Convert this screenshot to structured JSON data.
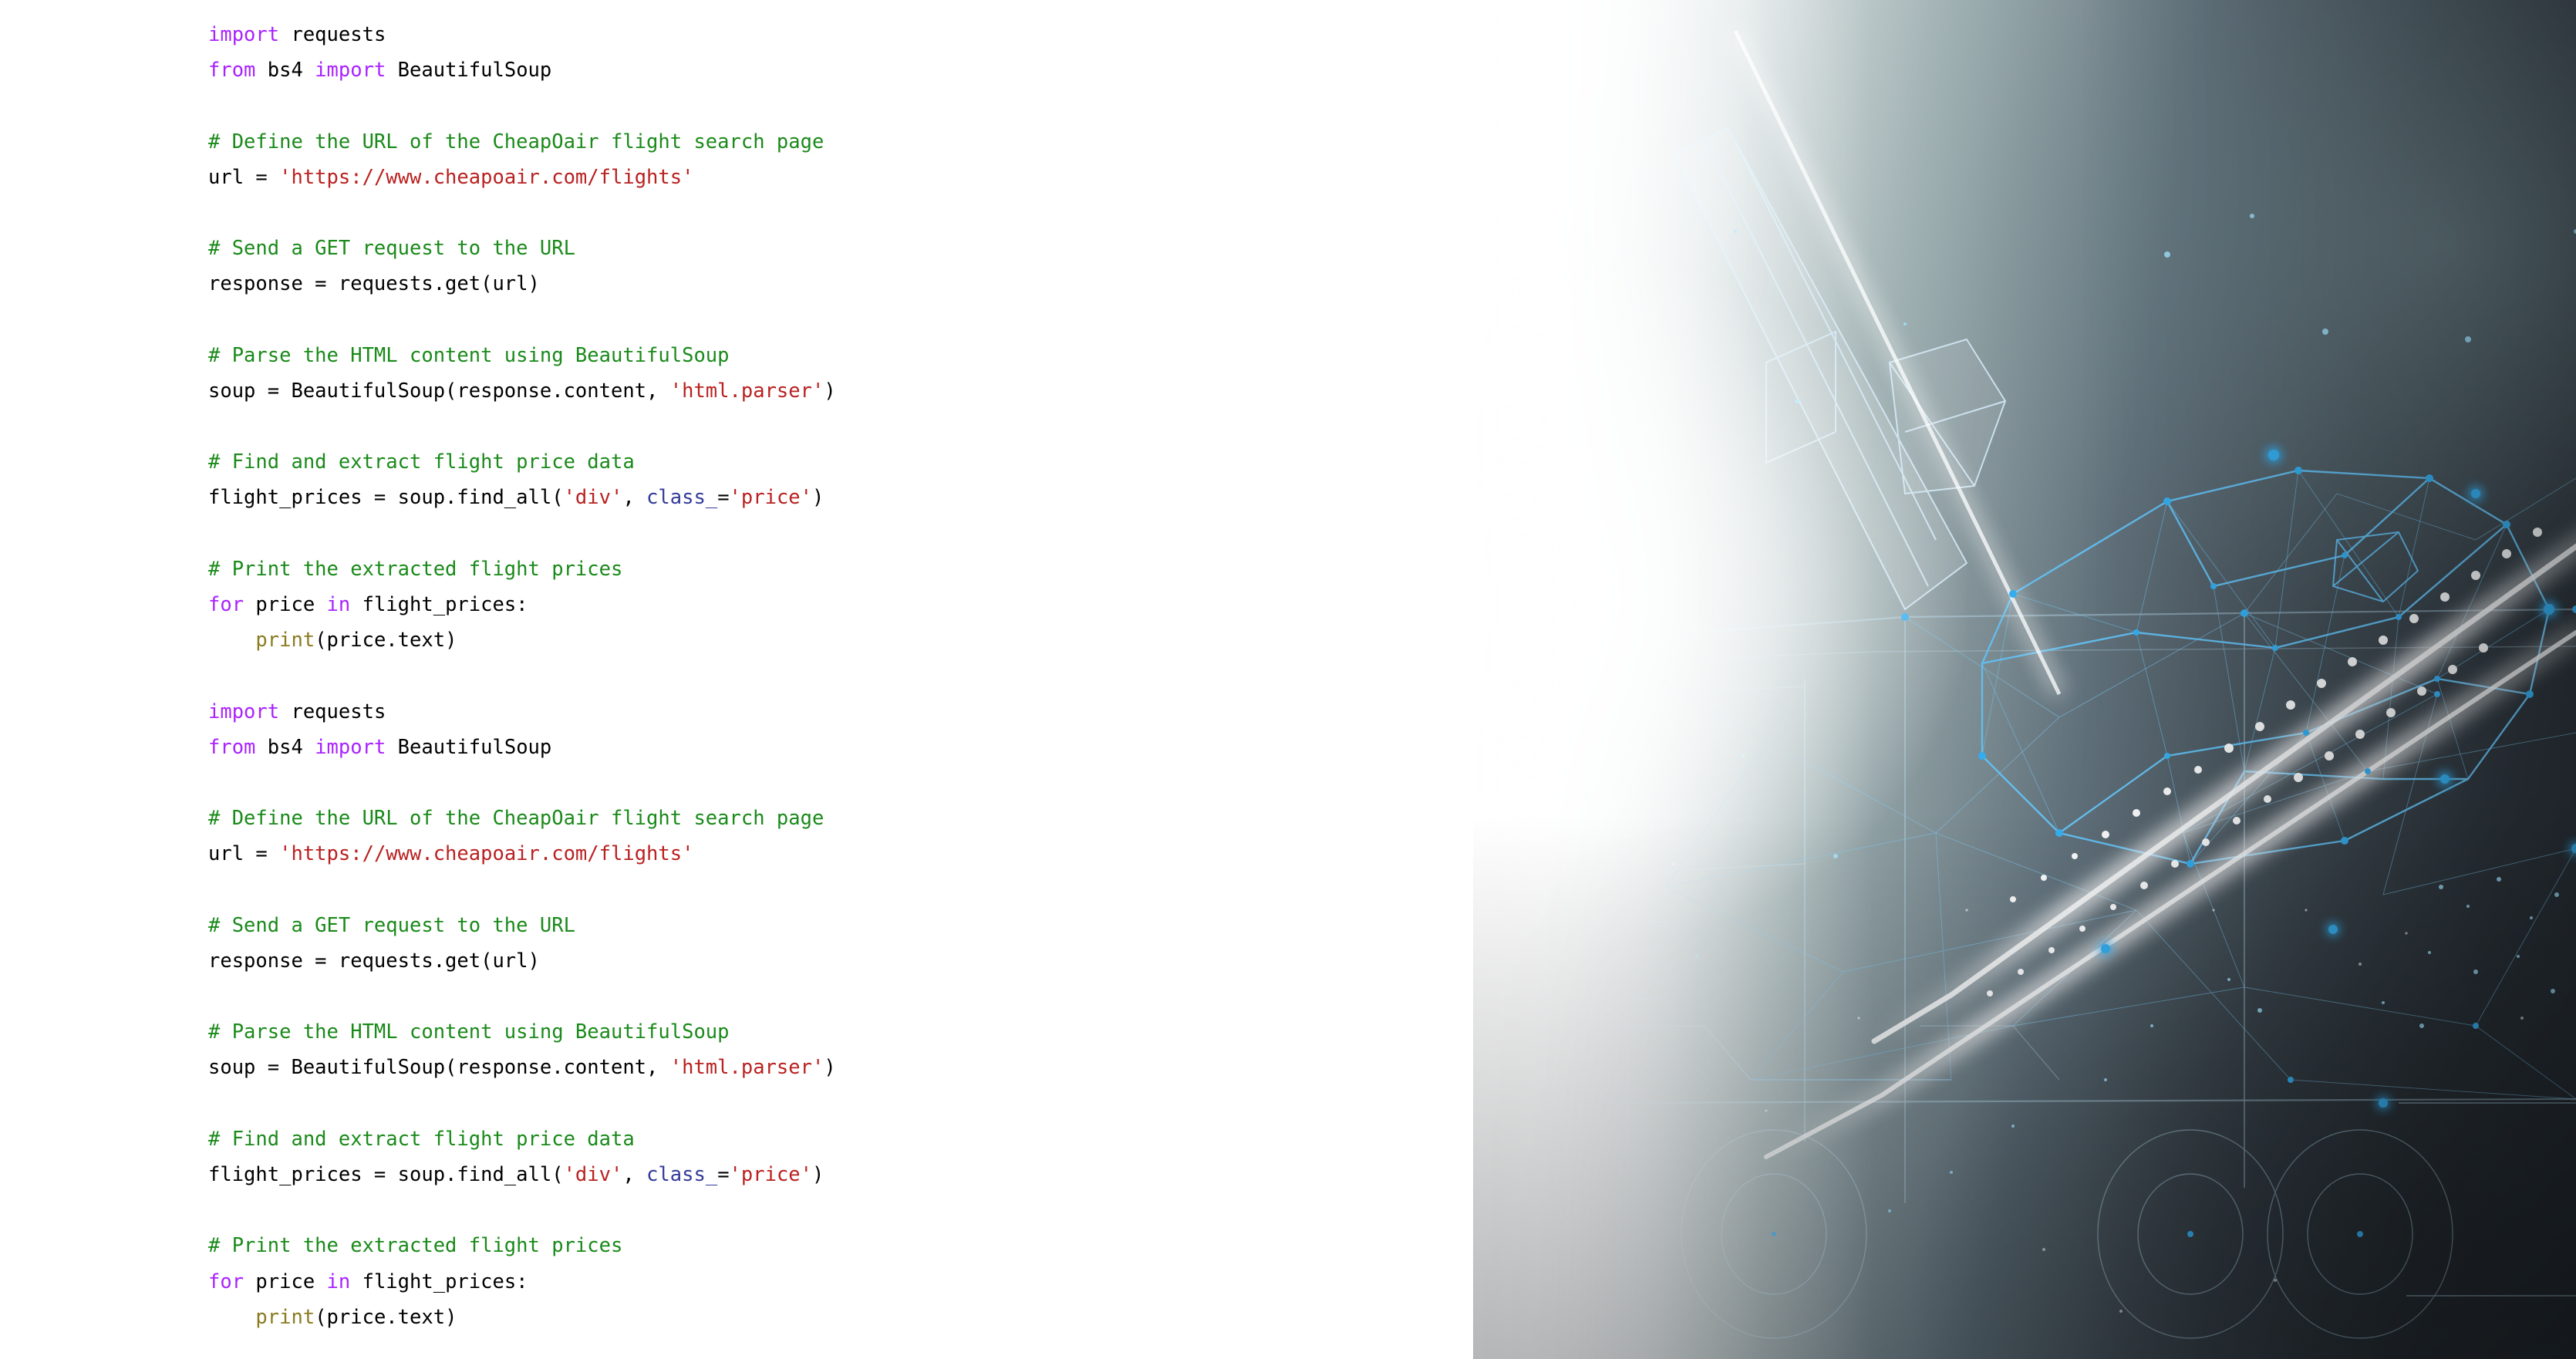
{
  "slide": {
    "background_color": "#ffffff",
    "accent_light_color": "#85B3E6",
    "accent_dark_color": "#1B4676"
  },
  "hero_image": {
    "name": "low-poly-wireframe-airplane-and-truck-logistics-graphic",
    "description": "Abstract polygonal wireframe of an airliner taking off above a cargo truck, glowing blue nodes and connecting lines over a grey-to-white gradient background",
    "accent_node_color": "#3FB0F2",
    "line_color": "#8FD2F7",
    "glow_color": "#CFEFFF"
  },
  "code": {
    "language": "python",
    "font_size_px": 25.5,
    "colors": {
      "keyword": "#AA22FF",
      "comment": "#1A8A1A",
      "string": "#BA2121",
      "builtin": "#8A7B1F",
      "keyword_argument": "#333B99",
      "text": "#000000"
    },
    "blocks": [
      {
        "name": "code-block-1",
        "lines": [
          [
            {
              "t": "import",
              "c": "kw"
            },
            {
              "t": " requests",
              "c": "txt"
            }
          ],
          [
            {
              "t": "from",
              "c": "kw"
            },
            {
              "t": " bs4 ",
              "c": "txt"
            },
            {
              "t": "import",
              "c": "kw"
            },
            {
              "t": " BeautifulSoup",
              "c": "txt"
            }
          ],
          [],
          [
            {
              "t": "# Define the URL of the CheapOair flight search page",
              "c": "cmt"
            }
          ],
          [
            {
              "t": "url = ",
              "c": "txt"
            },
            {
              "t": "'https://www.cheapoair.com/flights'",
              "c": "str"
            }
          ],
          [],
          [
            {
              "t": "# Send a GET request to the URL",
              "c": "cmt"
            }
          ],
          [
            {
              "t": "response = requests.get(url)",
              "c": "txt"
            }
          ],
          [],
          [
            {
              "t": "# Parse the HTML content using BeautifulSoup",
              "c": "cmt"
            }
          ],
          [
            {
              "t": "soup = BeautifulSoup(response.content, ",
              "c": "txt"
            },
            {
              "t": "'html.parser'",
              "c": "str"
            },
            {
              "t": ")",
              "c": "txt"
            }
          ],
          [],
          [
            {
              "t": "# Find and extract flight price data",
              "c": "cmt"
            }
          ],
          [
            {
              "t": "flight_prices = soup.find_all(",
              "c": "txt"
            },
            {
              "t": "'div'",
              "c": "str"
            },
            {
              "t": ", ",
              "c": "txt"
            },
            {
              "t": "class_",
              "c": "kwa"
            },
            {
              "t": "=",
              "c": "txt"
            },
            {
              "t": "'price'",
              "c": "str"
            },
            {
              "t": ")",
              "c": "txt"
            }
          ],
          [],
          [
            {
              "t": "# Print the extracted flight prices",
              "c": "cmt"
            }
          ],
          [
            {
              "t": "for",
              "c": "kw"
            },
            {
              "t": " price ",
              "c": "txt"
            },
            {
              "t": "in",
              "c": "kw"
            },
            {
              "t": " flight_prices:",
              "c": "txt"
            }
          ],
          [
            {
              "t": "    ",
              "c": "txt"
            },
            {
              "t": "print",
              "c": "bfn"
            },
            {
              "t": "(price.text)",
              "c": "txt"
            }
          ]
        ]
      },
      {
        "name": "code-block-2",
        "lines": [
          [],
          [
            {
              "t": "import",
              "c": "kw"
            },
            {
              "t": " requests",
              "c": "txt"
            }
          ],
          [
            {
              "t": "from",
              "c": "kw"
            },
            {
              "t": " bs4 ",
              "c": "txt"
            },
            {
              "t": "import",
              "c": "kw"
            },
            {
              "t": " BeautifulSoup",
              "c": "txt"
            }
          ],
          [],
          [
            {
              "t": "# Define the URL of the CheapOair flight search page",
              "c": "cmt"
            }
          ],
          [
            {
              "t": "url = ",
              "c": "txt"
            },
            {
              "t": "'https://www.cheapoair.com/flights'",
              "c": "str"
            }
          ],
          [],
          [
            {
              "t": "# Send a GET request to the URL",
              "c": "cmt"
            }
          ],
          [
            {
              "t": "response = requests.get(url)",
              "c": "txt"
            }
          ],
          [],
          [
            {
              "t": "# Parse the HTML content using BeautifulSoup",
              "c": "cmt"
            }
          ],
          [
            {
              "t": "soup = BeautifulSoup(response.content, ",
              "c": "txt"
            },
            {
              "t": "'html.parser'",
              "c": "str"
            },
            {
              "t": ")",
              "c": "txt"
            }
          ],
          [],
          [
            {
              "t": "# Find and extract flight price data",
              "c": "cmt"
            }
          ],
          [
            {
              "t": "flight_prices = soup.find_all(",
              "c": "txt"
            },
            {
              "t": "'div'",
              "c": "str"
            },
            {
              "t": ", ",
              "c": "txt"
            },
            {
              "t": "class_",
              "c": "kwa"
            },
            {
              "t": "=",
              "c": "txt"
            },
            {
              "t": "'price'",
              "c": "str"
            },
            {
              "t": ")",
              "c": "txt"
            }
          ],
          [],
          [
            {
              "t": "# Print the extracted flight prices",
              "c": "cmt"
            }
          ],
          [
            {
              "t": "for",
              "c": "kw"
            },
            {
              "t": " price ",
              "c": "txt"
            },
            {
              "t": "in",
              "c": "kw"
            },
            {
              "t": " flight_prices:",
              "c": "txt"
            }
          ],
          [
            {
              "t": "    ",
              "c": "txt"
            },
            {
              "t": "print",
              "c": "bfn"
            },
            {
              "t": "(price.text)",
              "c": "txt"
            }
          ]
        ]
      }
    ]
  }
}
